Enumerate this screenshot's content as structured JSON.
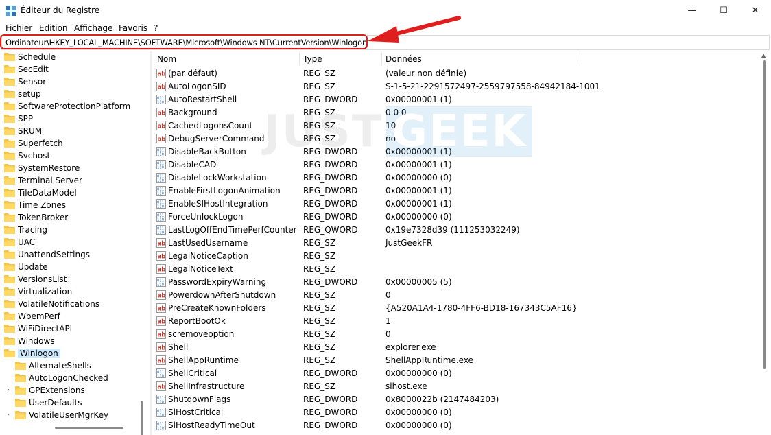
{
  "window": {
    "title": "Éditeur du Registre",
    "minimize": "—",
    "maximize": "☐",
    "close": "✕"
  },
  "menu": [
    "Fichier",
    "Edition",
    "Affichage",
    "Favoris",
    "?"
  ],
  "address": {
    "path": "Ordinateur\\HKEY_LOCAL_MACHINE\\SOFTWARE\\Microsoft\\Windows NT\\CurrentVersion\\Winlogon",
    "highlight_color": "#e01e1e"
  },
  "tree": {
    "items": [
      {
        "label": "Schedule"
      },
      {
        "label": "SecEdit"
      },
      {
        "label": "Sensor"
      },
      {
        "label": "setup"
      },
      {
        "label": "SoftwareProtectionPlatform"
      },
      {
        "label": "SPP"
      },
      {
        "label": "SRUM"
      },
      {
        "label": "Superfetch"
      },
      {
        "label": "Svchost"
      },
      {
        "label": "SystemRestore"
      },
      {
        "label": "Terminal Server"
      },
      {
        "label": "TileDataModel"
      },
      {
        "label": "Time Zones"
      },
      {
        "label": "TokenBroker"
      },
      {
        "label": "Tracing"
      },
      {
        "label": "UAC"
      },
      {
        "label": "UnattendSettings"
      },
      {
        "label": "Update"
      },
      {
        "label": "VersionsList"
      },
      {
        "label": "Virtualization"
      },
      {
        "label": "VolatileNotifications"
      },
      {
        "label": "WbemPerf"
      },
      {
        "label": "WiFiDirectAPI"
      },
      {
        "label": "Windows"
      },
      {
        "label": "Winlogon",
        "selected": true
      }
    ],
    "children": [
      {
        "label": "AlternateShells",
        "expandable": false
      },
      {
        "label": "AutoLogonChecked",
        "expandable": false
      },
      {
        "label": "GPExtensions",
        "expandable": true
      },
      {
        "label": "UserDefaults",
        "expandable": false
      },
      {
        "label": "VolatileUserMgrKey",
        "expandable": true
      }
    ]
  },
  "columns": {
    "name": "Nom",
    "type": "Type",
    "data": "Données"
  },
  "values": [
    {
      "name": "(par défaut)",
      "type": "REG_SZ",
      "data": "(valeur non définie)",
      "icon": "string-value-icon"
    },
    {
      "name": "AutoLogonSID",
      "type": "REG_SZ",
      "data": "S-1-5-21-2291572497-2559797558-84942184-1001",
      "icon": "string-value-icon"
    },
    {
      "name": "AutoRestartShell",
      "type": "REG_DWORD",
      "data": "0x00000001 (1)",
      "icon": "binary-value-icon"
    },
    {
      "name": "Background",
      "type": "REG_SZ",
      "data": "0 0 0",
      "icon": "string-value-icon"
    },
    {
      "name": "CachedLogonsCount",
      "type": "REG_SZ",
      "data": "10",
      "icon": "string-value-icon"
    },
    {
      "name": "DebugServerCommand",
      "type": "REG_SZ",
      "data": "no",
      "icon": "string-value-icon"
    },
    {
      "name": "DisableBackButton",
      "type": "REG_DWORD",
      "data": "0x00000001 (1)",
      "icon": "binary-value-icon"
    },
    {
      "name": "DisableCAD",
      "type": "REG_DWORD",
      "data": "0x00000001 (1)",
      "icon": "binary-value-icon"
    },
    {
      "name": "DisableLockWorkstation",
      "type": "REG_DWORD",
      "data": "0x00000000 (0)",
      "icon": "binary-value-icon"
    },
    {
      "name": "EnableFirstLogonAnimation",
      "type": "REG_DWORD",
      "data": "0x00000001 (1)",
      "icon": "binary-value-icon"
    },
    {
      "name": "EnableSIHostIntegration",
      "type": "REG_DWORD",
      "data": "0x00000001 (1)",
      "icon": "binary-value-icon"
    },
    {
      "name": "ForceUnlockLogon",
      "type": "REG_DWORD",
      "data": "0x00000000 (0)",
      "icon": "binary-value-icon"
    },
    {
      "name": "LastLogOffEndTimePerfCounter",
      "type": "REG_QWORD",
      "data": "0x19e7328d39 (111253032249)",
      "icon": "binary-value-icon"
    },
    {
      "name": "LastUsedUsername",
      "type": "REG_SZ",
      "data": "JustGeekFR",
      "icon": "string-value-icon"
    },
    {
      "name": "LegalNoticeCaption",
      "type": "REG_SZ",
      "data": "",
      "icon": "string-value-icon"
    },
    {
      "name": "LegalNoticeText",
      "type": "REG_SZ",
      "data": "",
      "icon": "string-value-icon"
    },
    {
      "name": "PasswordExpiryWarning",
      "type": "REG_DWORD",
      "data": "0x00000005 (5)",
      "icon": "binary-value-icon"
    },
    {
      "name": "PowerdownAfterShutdown",
      "type": "REG_SZ",
      "data": "0",
      "icon": "string-value-icon"
    },
    {
      "name": "PreCreateKnownFolders",
      "type": "REG_SZ",
      "data": "{A520A1A4-1780-4FF6-BD18-167343C5AF16}",
      "icon": "string-value-icon"
    },
    {
      "name": "ReportBootOk",
      "type": "REG_SZ",
      "data": "1",
      "icon": "string-value-icon"
    },
    {
      "name": "scremoveoption",
      "type": "REG_SZ",
      "data": "0",
      "icon": "string-value-icon"
    },
    {
      "name": "Shell",
      "type": "REG_SZ",
      "data": "explorer.exe",
      "icon": "string-value-icon"
    },
    {
      "name": "ShellAppRuntime",
      "type": "REG_SZ",
      "data": "ShellAppRuntime.exe",
      "icon": "string-value-icon"
    },
    {
      "name": "ShellCritical",
      "type": "REG_DWORD",
      "data": "0x00000000 (0)",
      "icon": "binary-value-icon"
    },
    {
      "name": "ShellInfrastructure",
      "type": "REG_SZ",
      "data": "sihost.exe",
      "icon": "string-value-icon"
    },
    {
      "name": "ShutdownFlags",
      "type": "REG_DWORD",
      "data": "0x8000022b (2147484203)",
      "icon": "binary-value-icon"
    },
    {
      "name": "SiHostCritical",
      "type": "REG_DWORD",
      "data": "0x00000000 (0)",
      "icon": "binary-value-icon"
    },
    {
      "name": "SiHostReadyTimeOut",
      "type": "REG_DWORD",
      "data": "0x00000000 (0)",
      "icon": "binary-value-icon"
    }
  ],
  "watermark": {
    "part1": "JUST",
    "part2": "GEEK"
  },
  "colors": {
    "selection": "#cce8ff",
    "folder": "#f4c542",
    "string_icon": "#c0392b",
    "binary_icon": "#2a6fbd"
  }
}
